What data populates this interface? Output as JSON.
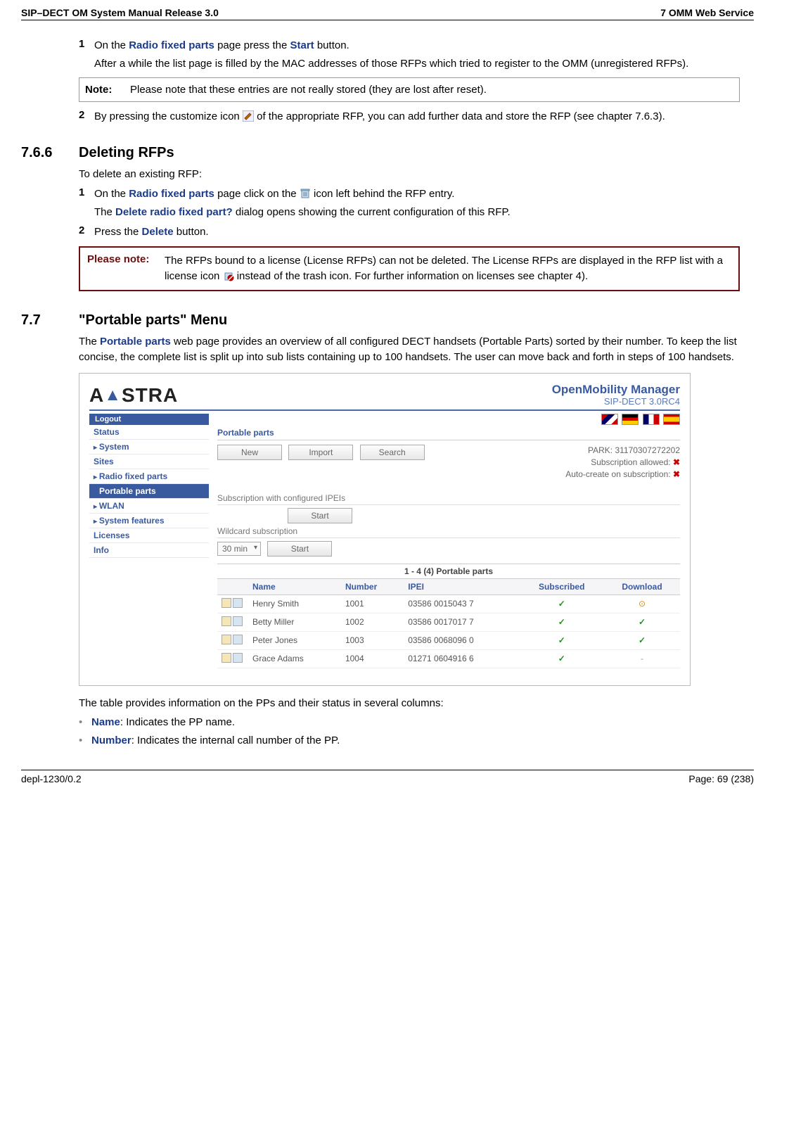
{
  "header": {
    "left": "SIP–DECT OM System Manual Release 3.0",
    "right": "7 OMM Web Service"
  },
  "s765": {
    "step1_num": "1",
    "step1_a": "On the ",
    "step1_link1": "Radio fixed parts",
    "step1_b": " page press the ",
    "step1_link2": "Start",
    "step1_c": " button.",
    "step1_cont": "After a while the list page is filled by the MAC addresses of those RFPs which tried to register to the OMM (unregistered RFPs).",
    "note_label": "Note:",
    "note_text": "Please note that these entries are not really stored (they are lost after reset).",
    "step2_num": "2",
    "step2_a": "By pressing the customize icon ",
    "step2_b": " of the appropriate RFP, you can add further data and store the RFP (see chapter 7.6.3)."
  },
  "s766": {
    "num": "7.6.6",
    "title": "Deleting RFPs",
    "intro": "To delete an existing RFP:",
    "step1_num": "1",
    "step1_a": "On the ",
    "step1_link1": "Radio fixed parts",
    "step1_b": " page click on the ",
    "step1_c": " icon left behind the RFP entry.",
    "step1_cont_a": "The ",
    "step1_cont_link": "Delete radio fixed part?",
    "step1_cont_b": " dialog opens showing the current configuration of this RFP.",
    "step2_num": "2",
    "step2_a": "Press the ",
    "step2_link": "Delete",
    "step2_b": " button.",
    "pnote_label": "Please note:",
    "pnote_text_a": "The RFPs bound to a license (License RFPs) can not be deleted. The License RFPs are displayed in the RFP list with a license icon ",
    "pnote_text_b": " instead of the trash icon. For further information on licenses see chapter 4)."
  },
  "s77": {
    "num": "7.7",
    "title": "\"Portable parts\" Menu",
    "para_a": "The ",
    "para_link": "Portable parts",
    "para_b": " web page provides an overview of all configured DECT handsets (Portable Parts) sorted by their number. To keep the list concise, the complete list is split up into sub lists containing up to 100 handsets. The user can move back and forth in steps of 100 handsets.",
    "after_shot": "The table provides information on the PPs and their status in several columns:",
    "bullet1_link": "Name",
    "bullet1_text": ": Indicates the PP name.",
    "bullet2_link": "Number",
    "bullet2_text": ": Indicates the internal call number of the PP."
  },
  "shot": {
    "brand_a": "A",
    "brand_b": "STRA",
    "title": "OpenMobility Manager",
    "subtitle": "SIP-DECT 3.0RC4",
    "logout": "Logout",
    "side": {
      "status": "Status",
      "system": "System",
      "sites": "Sites",
      "rfp": "Radio fixed parts",
      "pp": "Portable parts",
      "wlan": "WLAN",
      "features": "System features",
      "licenses": "Licenses",
      "info": "Info"
    },
    "content": {
      "heading": "Portable parts",
      "btn_new": "New",
      "btn_import": "Import",
      "btn_search": "Search",
      "park": "PARK: 31170307272202",
      "sub_allowed": "Subscription allowed: ",
      "auto_create": "Auto-create on subscription: ",
      "field1": "Subscription with configured IPEIs",
      "btn_start1": "Start",
      "field2": "Wildcard subscription",
      "select_val": "30 min",
      "btn_start2": "Start",
      "table_title": "1 - 4 (4) Portable parts",
      "cols": {
        "name": "Name",
        "number": "Number",
        "ipei": "IPEI",
        "subscribed": "Subscribed",
        "download": "Download"
      },
      "rows": [
        {
          "name": "Henry Smith",
          "number": "1001",
          "ipei": "03586 0015043 7",
          "sub": "✓",
          "dl": "⊙"
        },
        {
          "name": "Betty Miller",
          "number": "1002",
          "ipei": "03586 0017017 7",
          "sub": "✓",
          "dl": "✓"
        },
        {
          "name": "Peter Jones",
          "number": "1003",
          "ipei": "03586 0068096 0",
          "sub": "✓",
          "dl": "✓"
        },
        {
          "name": "Grace Adams",
          "number": "1004",
          "ipei": "01271 0604916 6",
          "sub": "✓",
          "dl": "-"
        }
      ]
    }
  },
  "footer": {
    "left": "depl-1230/0.2",
    "right": "Page: 69 (238)"
  }
}
